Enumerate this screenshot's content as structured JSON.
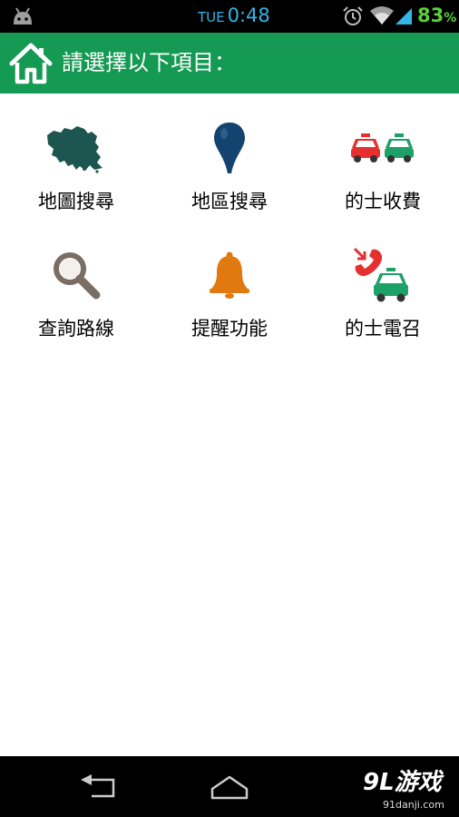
{
  "status_bar": {
    "day": "TUE",
    "time": "0:48",
    "battery_value": "83",
    "battery_unit": "%",
    "icons": [
      "android-icon",
      "alarm-icon",
      "wifi-icon",
      "signal-icon"
    ],
    "clock_color": "#33b5e5",
    "battery_color": "#5ad03a"
  },
  "header": {
    "title": "請選擇以下項目：",
    "background_color": "#149a52",
    "icon": "home-icon"
  },
  "menu": {
    "items": [
      {
        "label": "地圖搜尋",
        "icon": "map-icon"
      },
      {
        "label": "地區搜尋",
        "icon": "location-pin-icon"
      },
      {
        "label": "的士收費",
        "icon": "taxi-fare-icon"
      },
      {
        "label": "查詢路線",
        "icon": "magnifier-icon"
      },
      {
        "label": "提醒功能",
        "icon": "bell-icon"
      },
      {
        "label": "的士電召",
        "icon": "taxi-call-icon"
      }
    ]
  },
  "nav_bar": {
    "icons": [
      "back-icon",
      "home-nav-icon"
    ],
    "watermark_logo": "9L游戏",
    "watermark_url": "91danji.com"
  }
}
